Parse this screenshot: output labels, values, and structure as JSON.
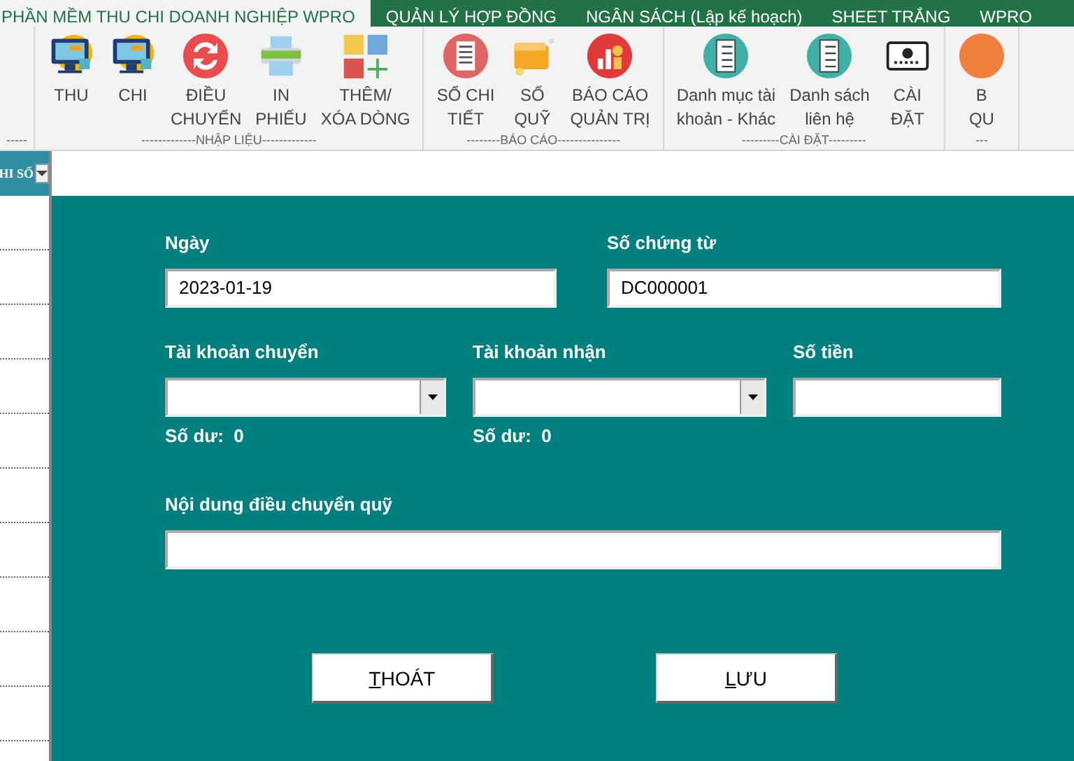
{
  "tabs": [
    {
      "label": "PHẦN MỀM THU CHI DOANH NGHIỆP WPRO",
      "selected": true
    },
    {
      "label": "QUẢN LÝ HỢP ĐỒNG",
      "selected": false
    },
    {
      "label": "NGÂN SÁCH (Lập kế hoạch)",
      "selected": false
    },
    {
      "label": "SHEET TRẮNG",
      "selected": false
    },
    {
      "label": "WPRO",
      "selected": false
    }
  ],
  "ribbon_groups": [
    {
      "label": "-----"
    },
    {
      "label": "-------------NHẬP LIỆU-------------",
      "buttons": [
        {
          "label": "THU",
          "kind": "monitor"
        },
        {
          "label": "CHI",
          "kind": "monitor"
        },
        {
          "label": "ĐIỀU\nCHUYỂN",
          "kind": "transfer"
        },
        {
          "label": "IN\nPHIẾU",
          "kind": "printer"
        },
        {
          "label": "THÊM/\nXÓA DÒNG",
          "kind": "squares"
        }
      ]
    },
    {
      "label": "--------BÁO CÁO---------------",
      "buttons": [
        {
          "label": "SỔ CHI\nTIẾT",
          "kind": "ledger"
        },
        {
          "label": "SỔ\nQUỸ",
          "kind": "wallet"
        },
        {
          "label": "BÁO CÁO\nQUẢN TRỊ",
          "kind": "chart"
        }
      ]
    },
    {
      "label": "---------CÀI ĐẶT---------",
      "buttons": [
        {
          "label": "Danh mục tài\nkhoản - Khác",
          "kind": "checklist"
        },
        {
          "label": "Danh sách\nliên hệ",
          "kind": "checklist"
        },
        {
          "label": "CÀI\nĐẶT",
          "kind": "gear"
        }
      ]
    },
    {
      "label": "---",
      "buttons": [
        {
          "label": "B\nQU",
          "kind": "orange"
        }
      ]
    }
  ],
  "sheet": {
    "header": "HI SỐ"
  },
  "form": {
    "rows": [
      [
        {
          "label": "Ngày",
          "kind": "text",
          "value": "2023-01-19"
        },
        {
          "label": "Số chứng từ",
          "kind": "text",
          "value": "DC000001"
        }
      ],
      [
        {
          "label": "Tài khoản chuyển",
          "kind": "combo",
          "balance_label": "Số dư:",
          "balance": "0"
        },
        {
          "label": "Tài khoản nhận",
          "kind": "combo",
          "balance_label": "Số dư:",
          "balance": "0"
        },
        {
          "label": "Số tiền",
          "kind": "text"
        }
      ],
      [
        {
          "label": "Nội dung điều chuyển quỹ",
          "kind": "text"
        }
      ]
    ],
    "buttons": [
      {
        "label": "THOÁT",
        "mnemonic_first": true
      },
      {
        "label": "LƯU",
        "mnemonic_first": true
      }
    ]
  }
}
